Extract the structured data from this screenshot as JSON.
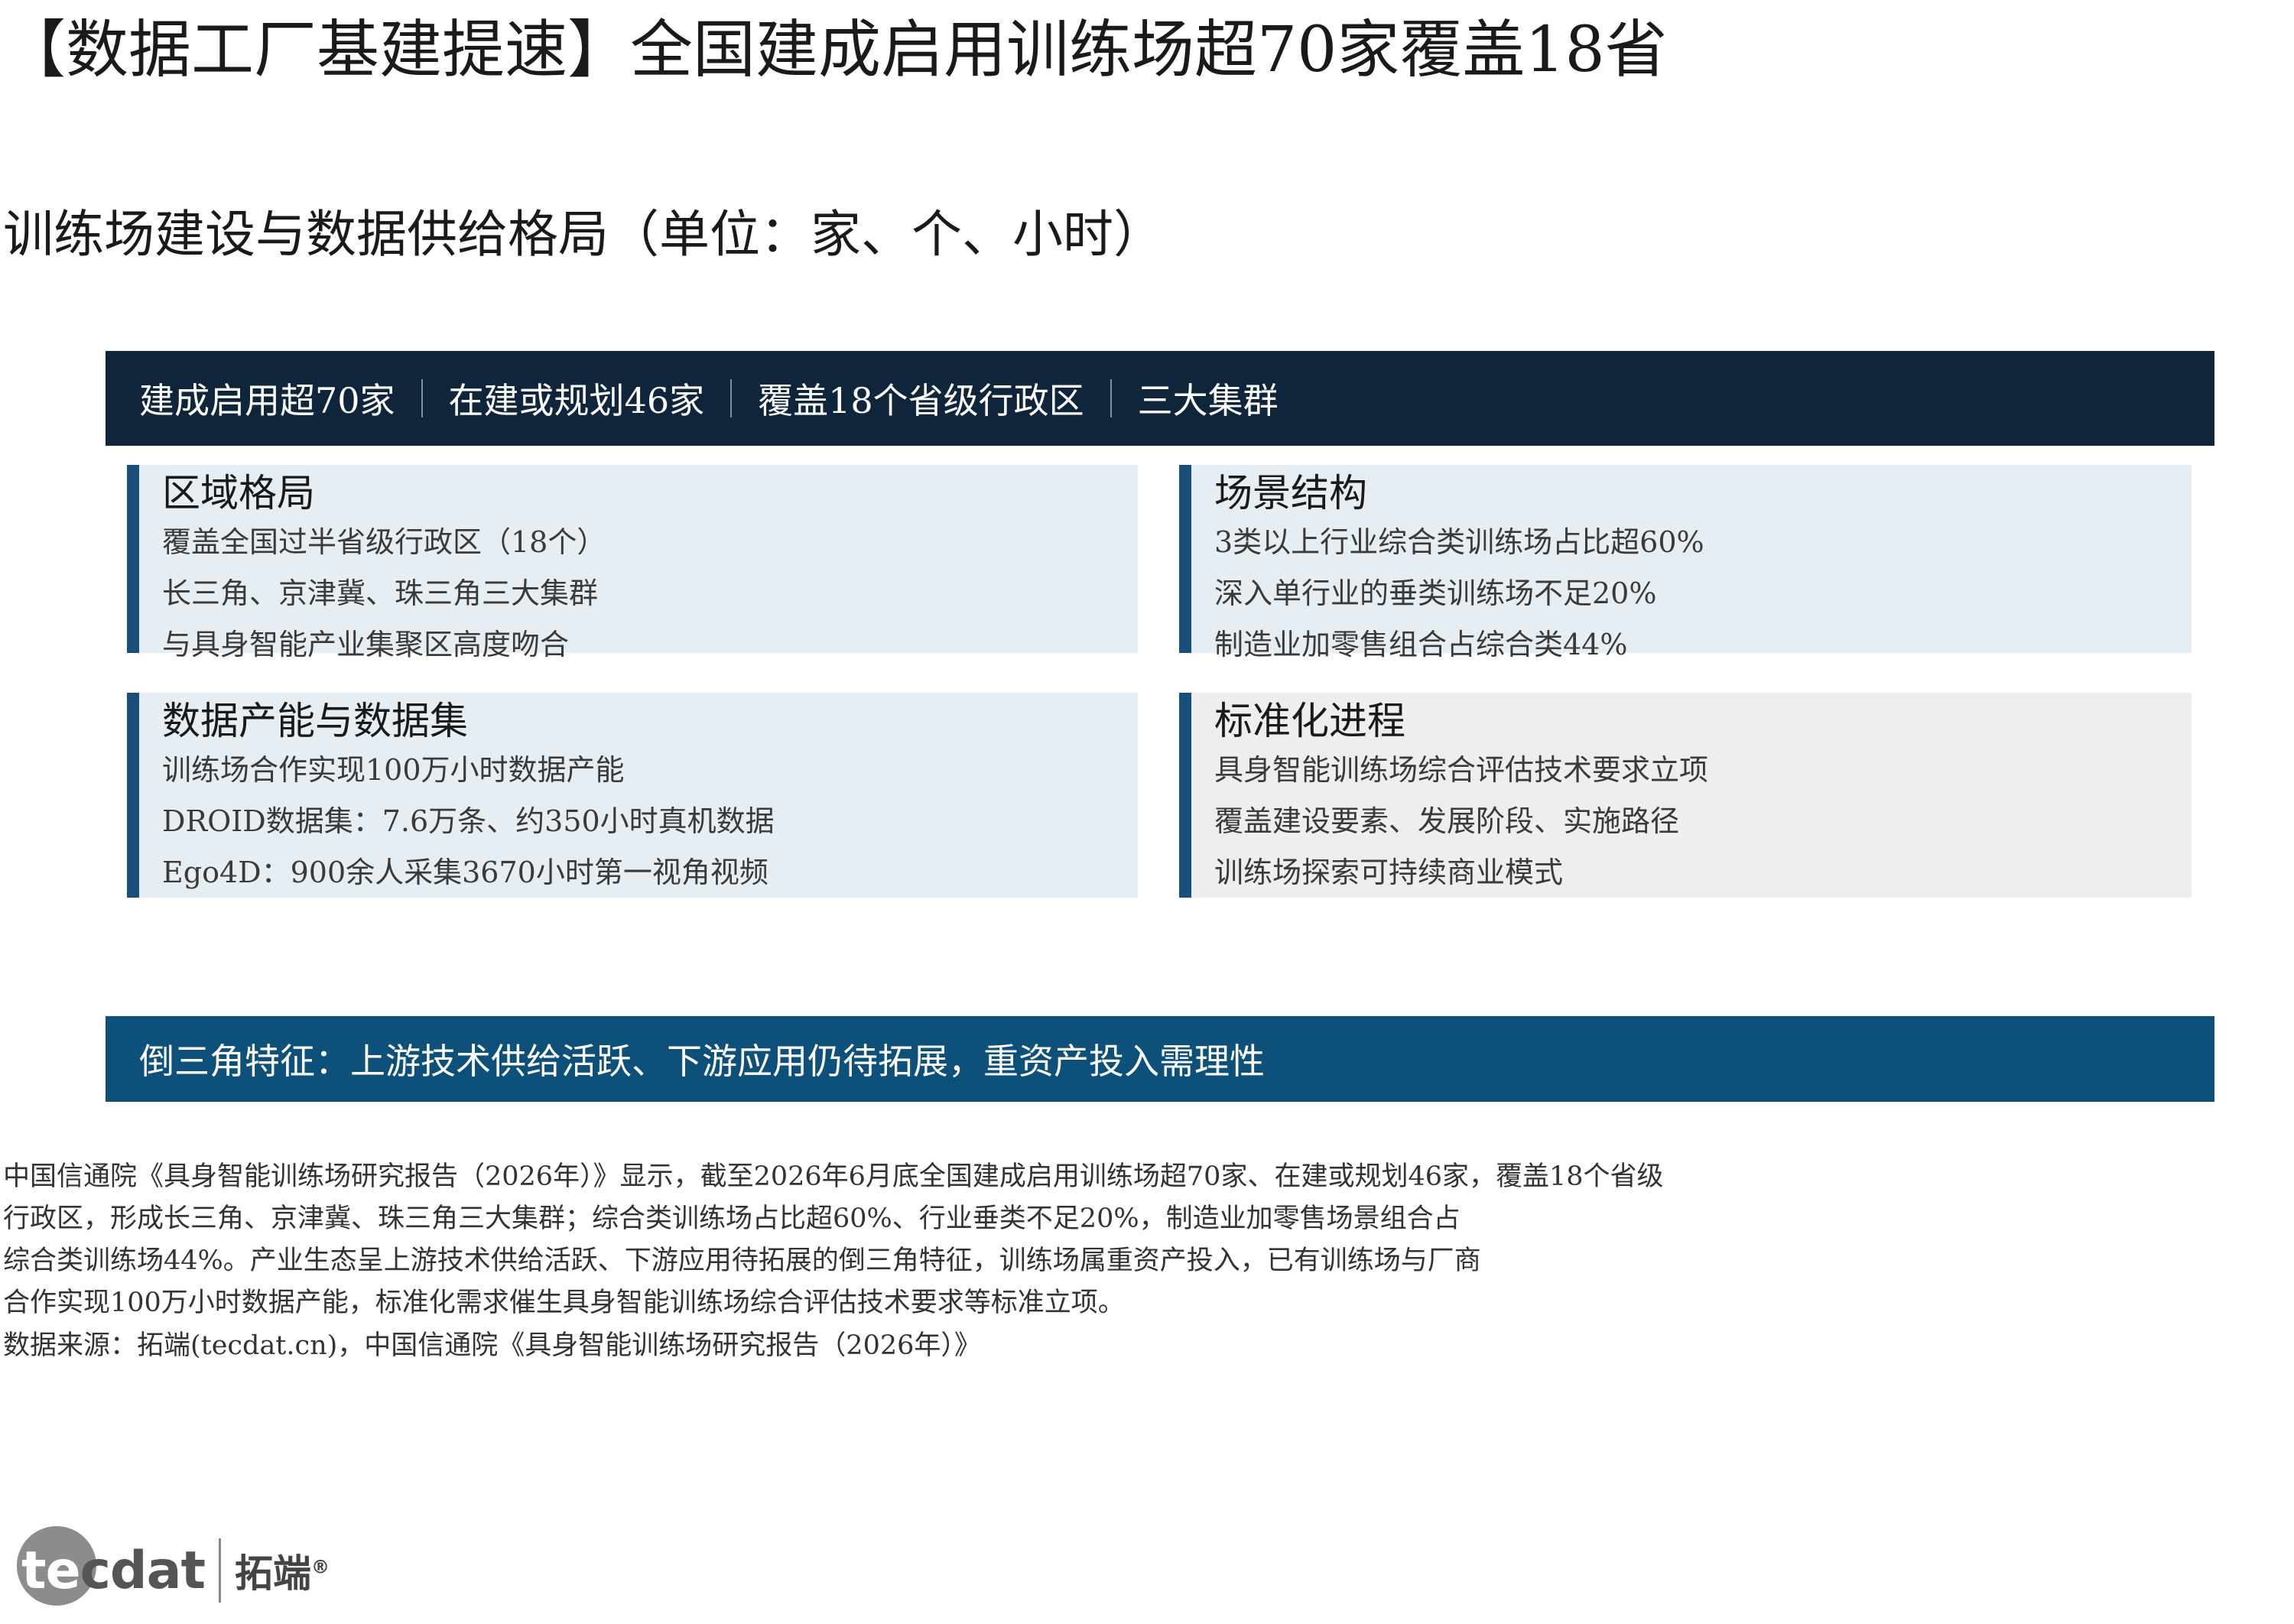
{
  "title": "【数据工厂基建提速】全国建成启用训练场超70家覆盖18省",
  "subtitle": "训练场建设与数据供给格局（单位：家、个、小时）",
  "top_bar": {
    "items": [
      "建成启用超70家",
      "在建或规划46家",
      "覆盖18个省级行政区",
      "三大集群"
    ]
  },
  "cards": [
    {
      "heading": "区域格局",
      "lines": [
        "覆盖全国过半省级行政区（18个）",
        "长三角、京津冀、珠三角三大集群",
        "与具身智能产业集聚区高度吻合"
      ]
    },
    {
      "heading": "场景结构",
      "lines": [
        "3类以上行业综合类训练场占比超60%",
        "深入单行业的垂类训练场不足20%",
        "制造业加零售组合占综合类44%"
      ]
    },
    {
      "heading": "数据产能与数据集",
      "lines": [
        "训练场合作实现100万小时数据产能",
        "DROID数据集：7.6万条、约350小时真机数据",
        "Ego4D：900余人采集3670小时第一视角视频"
      ]
    },
    {
      "heading": "标准化进程",
      "lines": [
        "具身智能训练场综合评估技术要求立项",
        "覆盖建设要素、发展阶段、实施路径",
        "训练场探索可持续商业模式"
      ]
    }
  ],
  "bottom_bar": "倒三角特征：上游技术供给活跃、下游应用仍待拓展，重资产投入需理性",
  "body_lines": [
    "中国信通院《具身智能训练场研究报告（2026年）》显示，截至2026年6月底全国建成启用训练场超70家、在建或规划46家，覆盖18个省级",
    "行政区，形成长三角、京津冀、珠三角三大集群；综合类训练场占比超60%、行业垂类不足20%，制造业加零售场景组合占",
    "综合类训练场44%。产业生态呈上游技术供给活跃、下游应用待拓展的倒三角特征，训练场属重资产投入，已有训练场与厂商",
    "合作实现100万小时数据产能，标准化需求催生具身智能训练场综合评估技术要求等标准立项。"
  ],
  "source": "数据来源：拓端(tecdat.cn)，中国信通院《具身智能训练场研究报告（2026年）》",
  "logo": {
    "te": "te",
    "cdat": "cdat",
    "cn": "拓端",
    "mark": "®"
  },
  "colors": {
    "dark_navy": "#0f253c",
    "accent_blue": "#0d5079",
    "card_blue": "#e6eef3",
    "card_gray": "#eeeeee"
  }
}
